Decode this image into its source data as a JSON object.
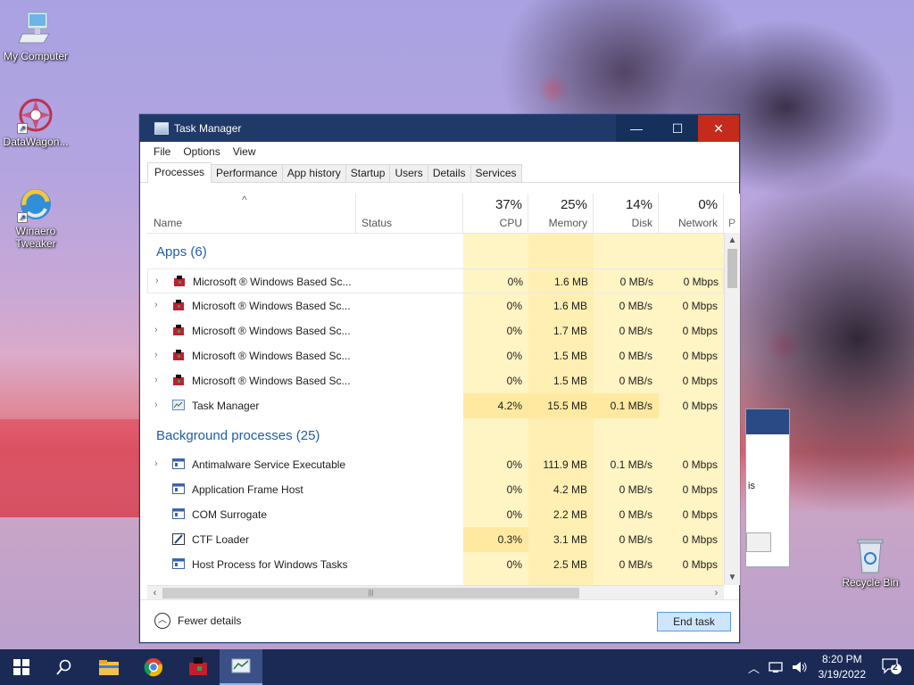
{
  "desktop": {
    "icons": [
      {
        "label": "My Computer",
        "icon": "computer-icon"
      },
      {
        "label": "DataWagon...",
        "icon": "datawagon-icon"
      },
      {
        "label": "Winaero Tweaker",
        "icon": "winaero-icon"
      },
      {
        "label": "Recycle Bin",
        "icon": "recycle-bin-icon"
      }
    ]
  },
  "window": {
    "title": "Task Manager",
    "minimize": "—",
    "maximize": "☐",
    "close": "✕"
  },
  "menu": [
    "File",
    "Options",
    "View"
  ],
  "tabs": [
    "Processes",
    "Performance",
    "App history",
    "Startup",
    "Users",
    "Details",
    "Services"
  ],
  "columns": {
    "sort_arrow": "^",
    "name": "Name",
    "status": "Status",
    "cpu": {
      "pct": "37%",
      "label": "CPU"
    },
    "memory": {
      "pct": "25%",
      "label": "Memory"
    },
    "disk": {
      "pct": "14%",
      "label": "Disk"
    },
    "network": {
      "pct": "0%",
      "label": "Network"
    },
    "power": "P"
  },
  "groups": {
    "apps": "Apps (6)",
    "background": "Background processes (25)"
  },
  "apps": [
    {
      "name": "Microsoft ® Windows Based Sc...",
      "cpu": "0%",
      "mem": "1.6 MB",
      "disk": "0 MB/s",
      "net": "0 Mbps"
    },
    {
      "name": "Microsoft ® Windows Based Sc...",
      "cpu": "0%",
      "mem": "1.6 MB",
      "disk": "0 MB/s",
      "net": "0 Mbps"
    },
    {
      "name": "Microsoft ® Windows Based Sc...",
      "cpu": "0%",
      "mem": "1.7 MB",
      "disk": "0 MB/s",
      "net": "0 Mbps"
    },
    {
      "name": "Microsoft ® Windows Based Sc...",
      "cpu": "0%",
      "mem": "1.5 MB",
      "disk": "0 MB/s",
      "net": "0 Mbps"
    },
    {
      "name": "Microsoft ® Windows Based Sc...",
      "cpu": "0%",
      "mem": "1.5 MB",
      "disk": "0 MB/s",
      "net": "0 Mbps"
    },
    {
      "name": "Task Manager",
      "cpu": "4.2%",
      "mem": "15.5 MB",
      "disk": "0.1 MB/s",
      "net": "0 Mbps"
    }
  ],
  "background": [
    {
      "name": "Antimalware Service Executable",
      "cpu": "0%",
      "mem": "111.9 MB",
      "disk": "0.1 MB/s",
      "net": "0 Mbps"
    },
    {
      "name": "Application Frame Host",
      "cpu": "0%",
      "mem": "4.2 MB",
      "disk": "0 MB/s",
      "net": "0 Mbps"
    },
    {
      "name": "COM Surrogate",
      "cpu": "0%",
      "mem": "2.2 MB",
      "disk": "0 MB/s",
      "net": "0 Mbps"
    },
    {
      "name": "CTF Loader",
      "cpu": "0.3%",
      "mem": "3.1 MB",
      "disk": "0 MB/s",
      "net": "0 Mbps"
    },
    {
      "name": "Host Process for Windows Tasks",
      "cpu": "0%",
      "mem": "2.5 MB",
      "disk": "0 MB/s",
      "net": "0 Mbps"
    }
  ],
  "footer": {
    "fewer_details": "Fewer details",
    "end_task": "End task"
  },
  "background_window": {
    "text": "is"
  },
  "taskbar": {
    "time": "8:20 PM",
    "date": "3/19/2022",
    "notifications": "2"
  },
  "colors": {
    "titlebar": "#1f3a68",
    "group_text": "#1f5ea8",
    "heat_light": "#fff4c4",
    "heat_medium": "#ffe9a0",
    "end_task_bg": "#cde6fb"
  }
}
